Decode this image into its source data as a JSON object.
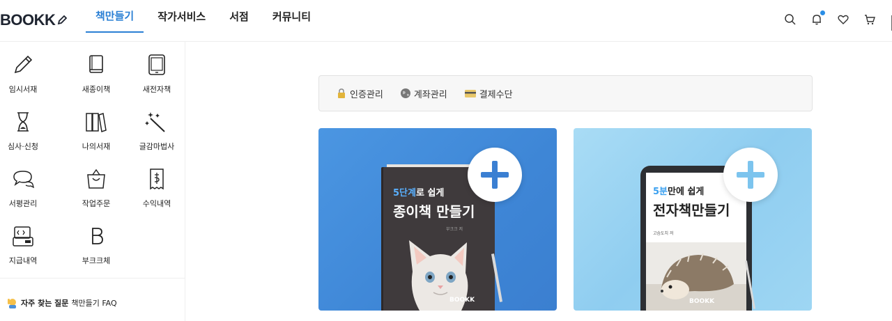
{
  "header": {
    "logo": "BOOKK",
    "nav": [
      {
        "label": "책만들기",
        "active": true
      },
      {
        "label": "작가서비스",
        "active": false
      },
      {
        "label": "서점",
        "active": false
      },
      {
        "label": "커뮤니티",
        "active": false
      }
    ],
    "icons": [
      "search-icon",
      "bell-icon",
      "heart-icon",
      "cart-icon"
    ],
    "notification_dot_color": "#2a8ee6"
  },
  "sidebar": {
    "items": [
      {
        "label": "임시서재",
        "icon": "pencil-icon"
      },
      {
        "label": "새종이책",
        "icon": "book-icon"
      },
      {
        "label": "새전자책",
        "icon": "tablet-icon"
      },
      {
        "label": "심사·신청",
        "icon": "hourglass-icon"
      },
      {
        "label": "나의서재",
        "icon": "bookshelf-icon"
      },
      {
        "label": "글감마법사",
        "icon": "magic-wand-icon"
      },
      {
        "label": "서평관리",
        "icon": "chat-bubbles-icon"
      },
      {
        "label": "작업주문",
        "icon": "shopping-bag-icon"
      },
      {
        "label": "수익내역",
        "icon": "receipt-icon"
      },
      {
        "label": "지급내역",
        "icon": "payment-icon"
      },
      {
        "label": "부크크체",
        "icon": "letter-b-icon"
      }
    ],
    "faq": {
      "title": "자주 찾는 질문",
      "sub": "책만들기 FAQ"
    }
  },
  "main": {
    "tabs": [
      {
        "label": "인증관리",
        "icon": "lock-icon"
      },
      {
        "label": "계좌관리",
        "icon": "globe-icon"
      },
      {
        "label": "결제수단",
        "icon": "credit-card-icon"
      }
    ],
    "cards": {
      "paper": {
        "line1_highlight": "5단계",
        "line1_rest": "로 쉽게",
        "line2": "종이책 만들기",
        "author": "부크크 저",
        "brand": "BOOKK"
      },
      "ebook": {
        "line1_highlight": "5분",
        "line1_rest": "만에 쉽게",
        "line2": "전자책만들기",
        "author": "고슴도치 저",
        "brand": "BOOKK"
      }
    }
  },
  "colors": {
    "accent": "#2a7fd4",
    "paper_card": "#3e86d6",
    "ebook_card": "#8fcdf0"
  }
}
